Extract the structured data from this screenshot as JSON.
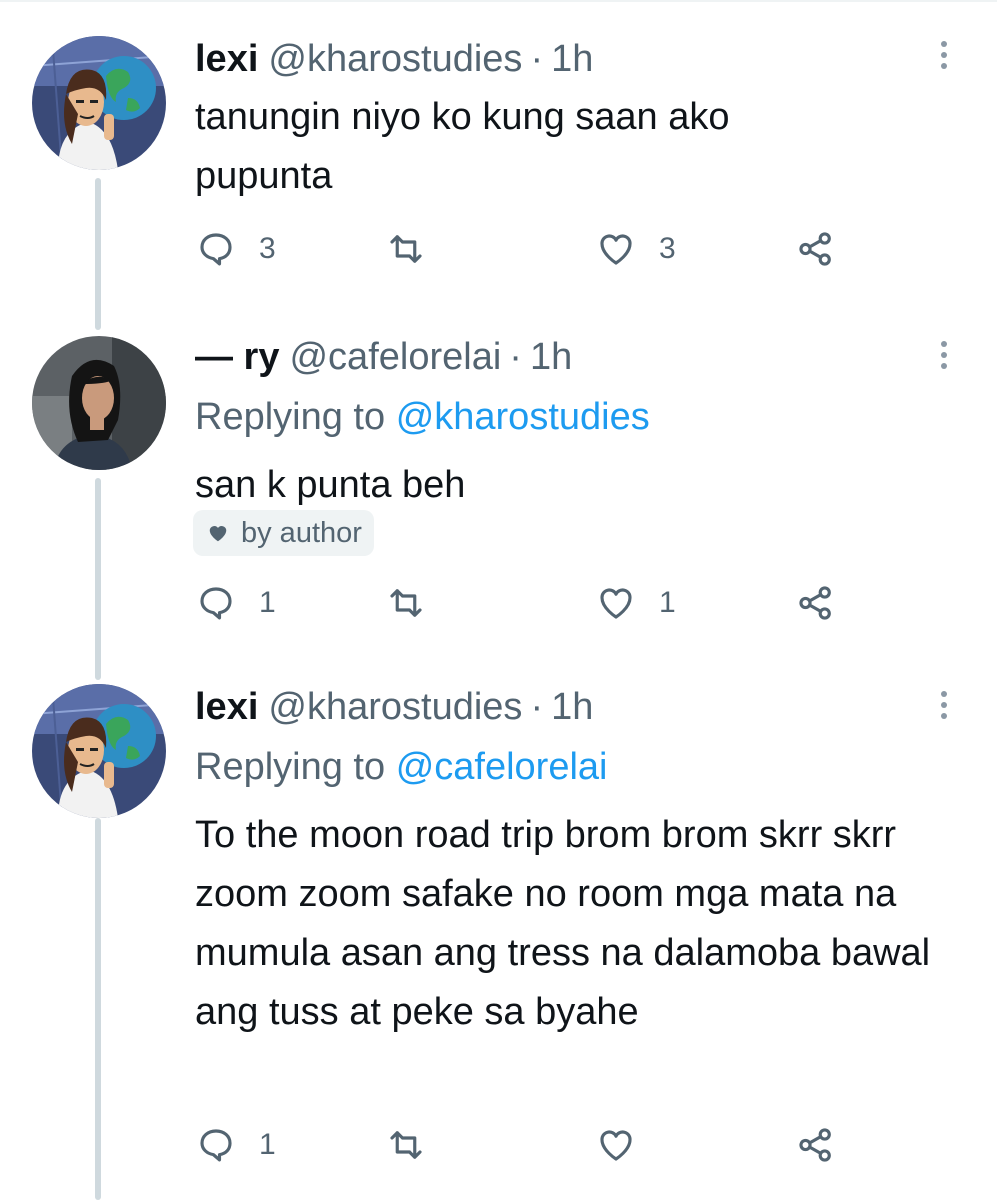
{
  "tweets": [
    {
      "name": "lexi",
      "handle": "@kharostudies",
      "dot": "·",
      "time": "1h",
      "replying_prefix": "",
      "replying_handle": "",
      "text": "tanungin niyo ko kung saan ako pupunta",
      "liked_by_author": "",
      "replies": "3",
      "retweets": "",
      "likes": "3"
    },
    {
      "name": "— ry",
      "handle": "@cafelorelai",
      "dot": "·",
      "time": "1h",
      "replying_prefix": "Replying to",
      "replying_handle": "@kharostudies",
      "text": "san k punta beh",
      "liked_by_author": "by author",
      "replies": "1",
      "retweets": "",
      "likes": "1"
    },
    {
      "name": "lexi",
      "handle": "@kharostudies",
      "dot": "·",
      "time": "1h",
      "replying_prefix": "Replying to",
      "replying_handle": "@cafelorelai",
      "text": "To the moon road trip brom brom skrr skrr zoom zoom safake no room mga mata na mumula asan ang tress na dalamoba bawal ang tuss at peke sa byahe",
      "liked_by_author": "",
      "replies": "1",
      "retweets": "",
      "likes": ""
    }
  ],
  "colors": {
    "text": "#0f1419",
    "secondary": "#536471",
    "mention": "#1d9bf0",
    "thread_line": "#cfd9de"
  },
  "icons": [
    "reply-icon",
    "retweet-icon",
    "like-icon",
    "share-icon",
    "more-icon",
    "heart-filled-icon"
  ]
}
